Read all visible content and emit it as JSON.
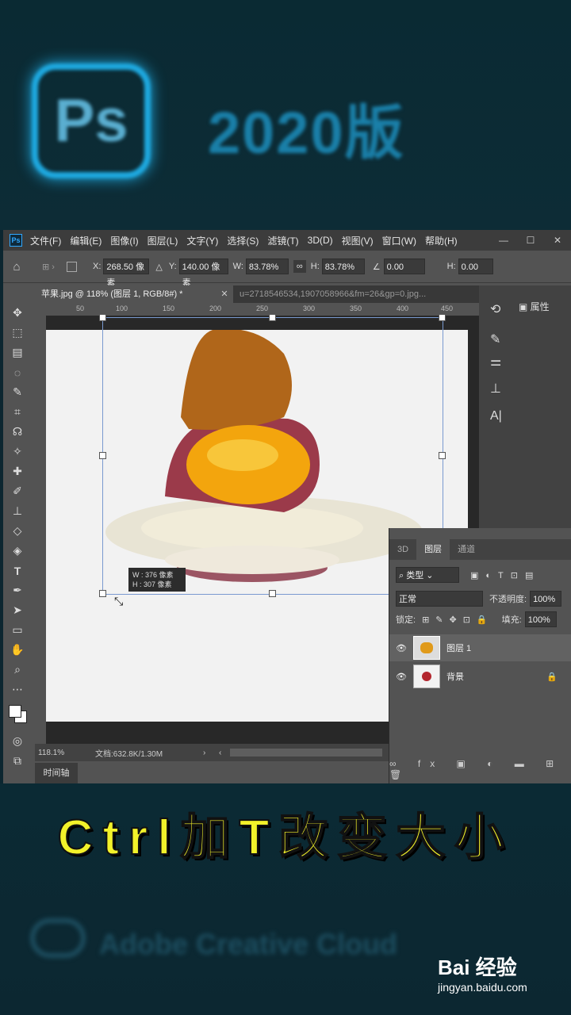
{
  "banner": {
    "logo_text": "Ps",
    "title": "2020版"
  },
  "menu": {
    "items": [
      "文件(F)",
      "编辑(E)",
      "图像(I)",
      "图层(L)",
      "文字(Y)",
      "选择(S)",
      "滤镜(T)",
      "3D(D)",
      "视图(V)",
      "窗口(W)",
      "帮助(H)"
    ],
    "window_controls": [
      "—",
      "☐",
      "✕"
    ]
  },
  "options": {
    "x_label": "X:",
    "x_value": "268.50 像素",
    "y_label": "Y:",
    "y_value": "140.00 像素",
    "w_label": "W:",
    "w_value": "83.78%",
    "h_label": "H:",
    "h_value": "83.78%",
    "angle_value": "0.00",
    "hskew_label": "H:",
    "hskew_value": "0.00"
  },
  "tabs": {
    "active": "苹果.jpg @ 118% (图层 1, RGB/8#) *",
    "inactive": "u=2718546534,1907058966&fm=26&gp=0.jpg..."
  },
  "ruler": {
    "ticks": [
      "50",
      "100",
      "150",
      "200",
      "250",
      "300",
      "350",
      "400",
      "450"
    ]
  },
  "transform_tooltip": {
    "w": "W : 376 像素",
    "h": "H : 307 像素"
  },
  "status": {
    "zoom": "118.1%",
    "doc": "文档:632.8K/1.30M"
  },
  "timeline_label": "时间轴",
  "properties_label": "属性",
  "layers_panel": {
    "tabs": [
      "3D",
      "图层",
      "通道"
    ],
    "filter_label": "类型",
    "blend_mode": "正常",
    "opacity_label": "不透明度:",
    "opacity_value": "100%",
    "lock_label": "锁定:",
    "fill_label": "填充:",
    "fill_value": "100%",
    "layers": [
      {
        "name": "图层 1"
      },
      {
        "name": "背景"
      }
    ]
  },
  "caption": "Ctrl加T改变大小",
  "cloud_text": "Adobe Creative Cloud",
  "watermark": {
    "brand": "Bai 经验",
    "url": "jingyan.baidu.com"
  }
}
